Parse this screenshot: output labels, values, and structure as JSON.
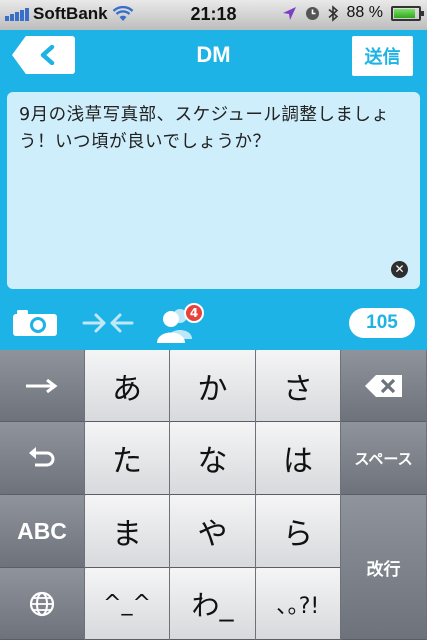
{
  "status_bar": {
    "carrier": "SoftBank",
    "time": "21:18",
    "battery_text": "88 %",
    "battery_level": 0.88,
    "icons": [
      "signal-bars-icon",
      "wifi-icon",
      "location-arrow-icon",
      "alarm-clock-icon",
      "bluetooth-icon",
      "battery-icon"
    ]
  },
  "navbar": {
    "title": "DM",
    "send_label": "送信"
  },
  "compose": {
    "text": "9月の浅草写真部、スケジュール調整しましょう！いつ頃が良いでしょうか？"
  },
  "toolbar": {
    "recipient_badge": "4",
    "char_count": "105"
  },
  "keyboard": {
    "rows": [
      [
        "→",
        "あ",
        "か",
        "さ",
        "⌫"
      ],
      [
        "↶",
        "た",
        "な",
        "は",
        "スペース"
      ],
      [
        "ABC",
        "ま",
        "や",
        "ら",
        "改行"
      ],
      [
        "🌐",
        "^^",
        "わ",
        "､｡?!"
      ]
    ],
    "keys": {
      "a": "あ",
      "ka": "か",
      "sa": "さ",
      "ta": "た",
      "na": "な",
      "ha": "は",
      "ma": "ま",
      "ya": "や",
      "ra": "ら",
      "emoticon": "^_^",
      "wa": "わ_",
      "punct": "､｡?!",
      "abc": "ABC",
      "space": "スペース",
      "return": "改行"
    }
  },
  "colors": {
    "accent": "#1eb3e6",
    "compose_bg": "#cfeefb",
    "badge": "#e8433a"
  }
}
